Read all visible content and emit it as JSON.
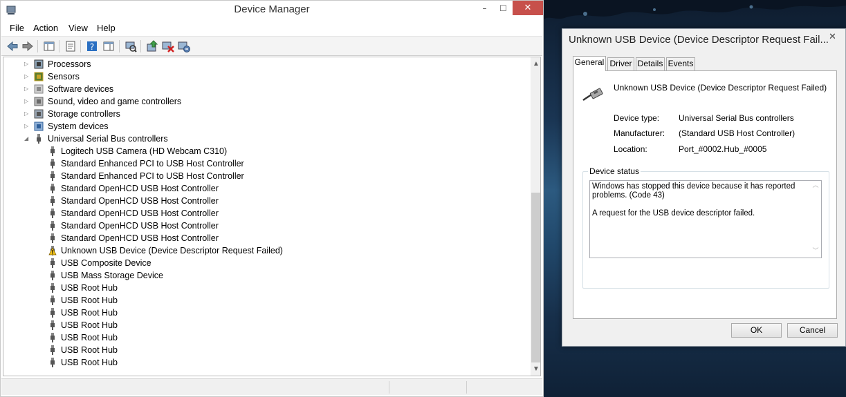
{
  "device_manager": {
    "title": "Device Manager",
    "window_buttons": {
      "minimize": "–",
      "maximize": "☐",
      "close": "✕"
    },
    "menu": [
      "File",
      "Action",
      "View",
      "Help"
    ],
    "toolbar_icons": [
      "back-arrow-icon",
      "forward-arrow-icon",
      "show-hide-console-tree-icon",
      "properties-icon",
      "help-icon",
      "action-pane-icon",
      "scan-hardware-icon",
      "update-driver-icon",
      "disable-device-icon",
      "uninstall-device-icon"
    ],
    "categories": [
      {
        "label": "Processors",
        "icon": "processor-icon",
        "expander": "▷"
      },
      {
        "label": "Sensors",
        "icon": "sensors-icon",
        "expander": "▷"
      },
      {
        "label": "Software devices",
        "icon": "software-device-icon",
        "expander": "▷"
      },
      {
        "label": "Sound, video and game controllers",
        "icon": "speaker-icon",
        "expander": "▷"
      },
      {
        "label": "Storage controllers",
        "icon": "storage-controller-icon",
        "expander": "▷"
      },
      {
        "label": "System devices",
        "icon": "system-devices-icon",
        "expander": "▷"
      },
      {
        "label": "Universal Serial Bus controllers",
        "icon": "usb-plug-icon",
        "expander": "◢"
      }
    ],
    "usb_devices": [
      {
        "label": "Logitech USB Camera (HD Webcam C310)",
        "warning": false
      },
      {
        "label": "Standard Enhanced PCI to USB Host Controller",
        "warning": false
      },
      {
        "label": "Standard Enhanced PCI to USB Host Controller",
        "warning": false
      },
      {
        "label": "Standard OpenHCD USB Host Controller",
        "warning": false
      },
      {
        "label": "Standard OpenHCD USB Host Controller",
        "warning": false
      },
      {
        "label": "Standard OpenHCD USB Host Controller",
        "warning": false
      },
      {
        "label": "Standard OpenHCD USB Host Controller",
        "warning": false
      },
      {
        "label": "Standard OpenHCD USB Host Controller",
        "warning": false
      },
      {
        "label": "Unknown USB Device (Device Descriptor Request Failed)",
        "warning": true
      },
      {
        "label": "USB Composite Device",
        "warning": false
      },
      {
        "label": "USB Mass Storage Device",
        "warning": false
      },
      {
        "label": "USB Root Hub",
        "warning": false
      },
      {
        "label": "USB Root Hub",
        "warning": false
      },
      {
        "label": "USB Root Hub",
        "warning": false
      },
      {
        "label": "USB Root Hub",
        "warning": false
      },
      {
        "label": "USB Root Hub",
        "warning": false
      },
      {
        "label": "USB Root Hub",
        "warning": false
      },
      {
        "label": "USB Root Hub",
        "warning": false
      }
    ],
    "scroll_arrows": {
      "up": "▲",
      "down": "▼"
    }
  },
  "properties_dialog": {
    "title": "Unknown USB Device (Device Descriptor Request Fail...",
    "close": "✕",
    "tabs": [
      "General",
      "Driver",
      "Details",
      "Events"
    ],
    "active_tab": "General",
    "device_name": "Unknown USB Device (Device Descriptor Request Failed)",
    "properties": [
      {
        "label": "Device type:",
        "value": "Universal Serial Bus controllers"
      },
      {
        "label": "Manufacturer:",
        "value": "(Standard USB Host Controller)"
      },
      {
        "label": "Location:",
        "value": "Port_#0002.Hub_#0005"
      }
    ],
    "status_group_label": "Device status",
    "status_lines": [
      "Windows has stopped this device because it has reported problems. (Code 43)",
      "A request for the USB device descriptor failed."
    ],
    "ok_label": "OK",
    "cancel_label": "Cancel"
  },
  "colors": {
    "close_button": "#c7504b",
    "warning_yellow": "#f5c518",
    "desktop_blue": "#2c5a80"
  }
}
